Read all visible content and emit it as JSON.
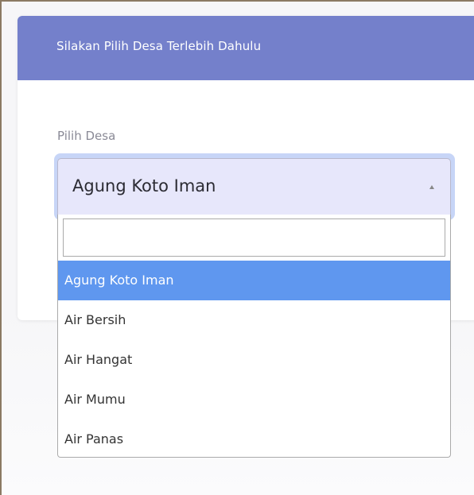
{
  "card": {
    "title": "Silakan Pilih Desa Terlebih Dahulu"
  },
  "form": {
    "label": "Pilih Desa",
    "selected_value": "Agung Koto Iman",
    "search_value": ""
  },
  "dropdown": {
    "options": [
      {
        "label": "Agung Koto Iman",
        "highlighted": true
      },
      {
        "label": "Air Bersih",
        "highlighted": false
      },
      {
        "label": "Air Hangat",
        "highlighted": false
      },
      {
        "label": "Air Mumu",
        "highlighted": false
      },
      {
        "label": "Air Panas",
        "highlighted": false
      }
    ]
  },
  "icons": {
    "select_arrow": "caret-up-icon"
  },
  "colors": {
    "header": "#7480cb",
    "select_background": "#e7e7fb",
    "focus_ring": "#c7d5f7",
    "highlight": "#5f97ef"
  }
}
